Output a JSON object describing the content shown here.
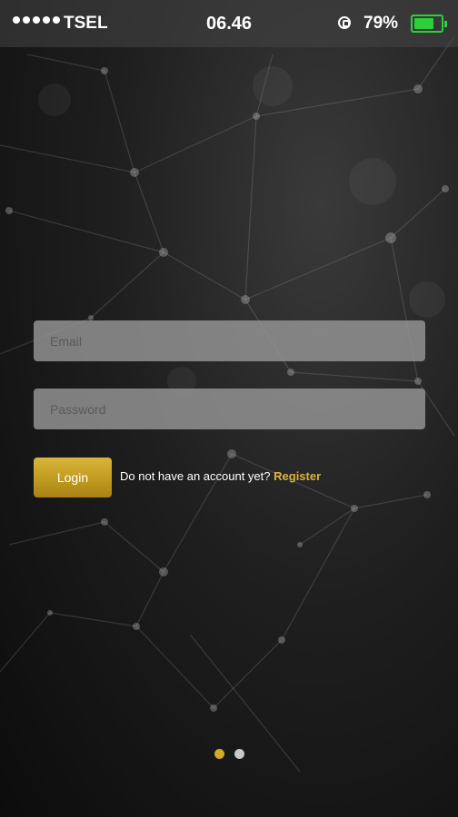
{
  "status_bar": {
    "carrier": "TSEL",
    "time": "06.46",
    "battery_percent": "79%",
    "battery_level": 0.79,
    "battery_color": "#2bd03b",
    "signal_dots": 5
  },
  "login_form": {
    "email_placeholder": "Email",
    "password_placeholder": "Password",
    "login_label": "Login",
    "register_prompt": "Do not have an account yet?",
    "register_link": "Register"
  },
  "pager": {
    "count": 2,
    "active_index": 0,
    "active_color": "#d4a82a"
  },
  "colors": {
    "accent": "#d9b23a",
    "button_gold": "#c39d22"
  }
}
